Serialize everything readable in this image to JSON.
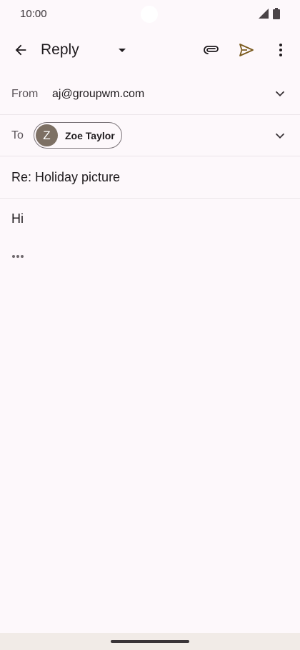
{
  "status_bar": {
    "time": "10:00"
  },
  "app_bar": {
    "title": "Reply",
    "icons": {
      "back": "arrow-back-icon",
      "dropdown": "arrow-drop-down-icon",
      "attach": "paperclip-icon",
      "send": "send-icon",
      "more": "more-vertical-icon"
    }
  },
  "compose": {
    "from_label": "From",
    "from_value": "aj@groupwm.com",
    "to_label": "To",
    "recipient": {
      "initial": "Z",
      "name": "Zoe Taylor"
    },
    "subject": "Re: Holiday picture",
    "body": "Hi"
  },
  "colors": {
    "background": "#fdf8fb",
    "send_accent": "#7a5a1e",
    "avatar": "#7d7064",
    "nav_bar": "#f1ebe7"
  }
}
